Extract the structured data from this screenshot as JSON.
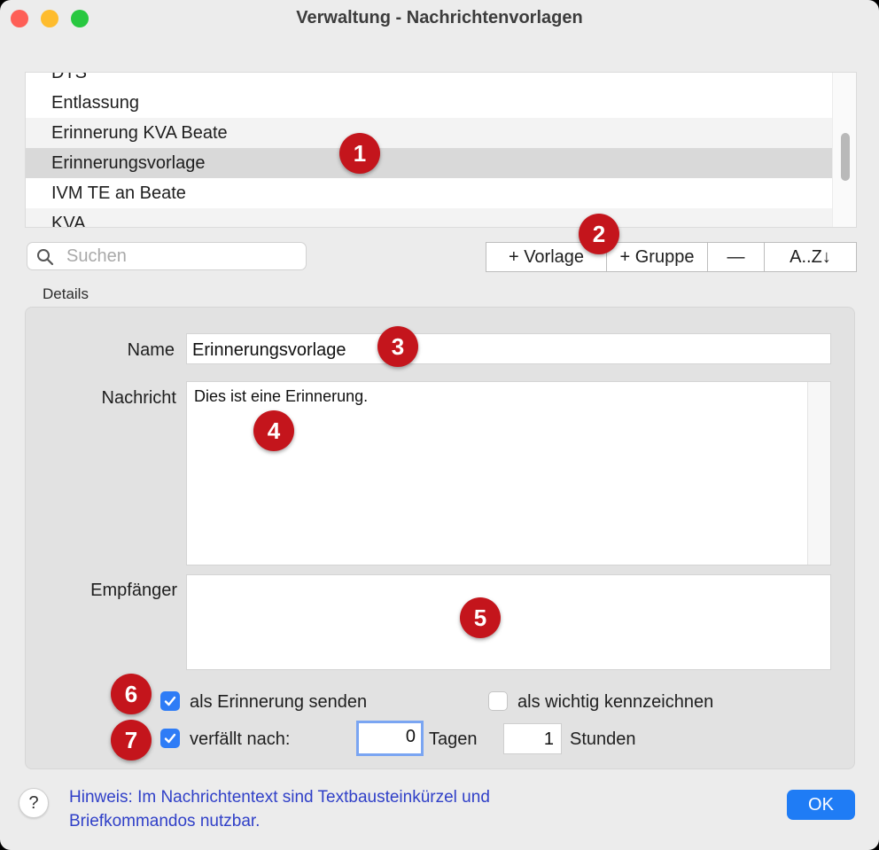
{
  "window": {
    "title": "Verwaltung - Nachrichtenvorlagen"
  },
  "list": {
    "items": [
      {
        "label": "DTS"
      },
      {
        "label": "Entlassung"
      },
      {
        "label": "Erinnerung KVA Beate"
      },
      {
        "label": "Erinnerungsvorlage",
        "selected": true
      },
      {
        "label": "IVM TE an Beate"
      },
      {
        "label": "KVA"
      }
    ]
  },
  "search": {
    "placeholder": "Suchen"
  },
  "toolbar": {
    "add_template_label": "+  Vorlage",
    "add_group_label": "+ Gruppe",
    "remove_label": "—",
    "sort_label": "A..Z↓"
  },
  "details": {
    "section_label": "Details",
    "name_label": "Name",
    "name_value": "Erinnerungsvorlage",
    "message_label": "Nachricht",
    "message_value": "Dies ist eine Erinnerung.",
    "recipient_label": "Empfänger",
    "recipient_value": "",
    "send_as_reminder_label": "als Erinnerung senden",
    "send_as_reminder_checked": true,
    "mark_important_label": "als wichtig kennzeichnen",
    "mark_important_checked": false,
    "expires_label": "verfällt nach:",
    "expires_checked": true,
    "days_value": "0",
    "days_label": "Tagen",
    "hours_value": "1",
    "hours_label": "Stunden"
  },
  "footer": {
    "help_label": "?",
    "hint_text": "Hinweis: Im Nachrichtentext sind Textbausteinkürzel und Briefkommandos nutzbar.",
    "ok_label": "OK"
  },
  "annotations": [
    "1",
    "2",
    "3",
    "4",
    "5",
    "6",
    "7"
  ],
  "colors": {
    "accent": "#2e7cf6",
    "badge": "#c4151c",
    "hint": "#3040c8"
  }
}
